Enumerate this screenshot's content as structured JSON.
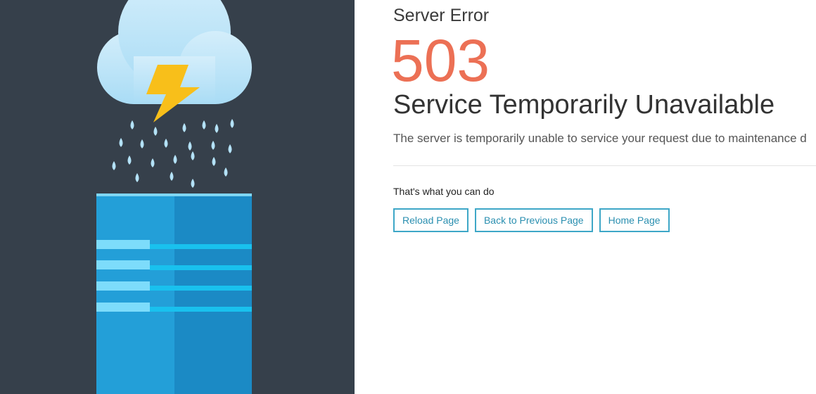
{
  "error": {
    "label": "Server Error",
    "code": "503",
    "title": "Service Temporarily Unavailable",
    "description": "The server is temporarily unable to service your request due to maintenance d"
  },
  "actions": {
    "heading": "That's what you can do",
    "buttons": [
      {
        "label": "Reload Page"
      },
      {
        "label": "Back to Previous Page"
      },
      {
        "label": "Home Page"
      }
    ]
  },
  "colors": {
    "sidebar_background": "#36404b",
    "error_code": "#ec7055",
    "button_border": "#3ea7c7",
    "button_text": "#2a8fb0",
    "server_light": "#239fd8",
    "server_dark": "#1b8ac5",
    "cloud": "#c5e7f8",
    "lightning": "#f8bf1a",
    "raindrop": "#b4e2f7"
  },
  "illustration": {
    "icons": [
      "cloud-icon",
      "lightning-bolt-icon",
      "raindrops-icon",
      "server-icon"
    ]
  }
}
